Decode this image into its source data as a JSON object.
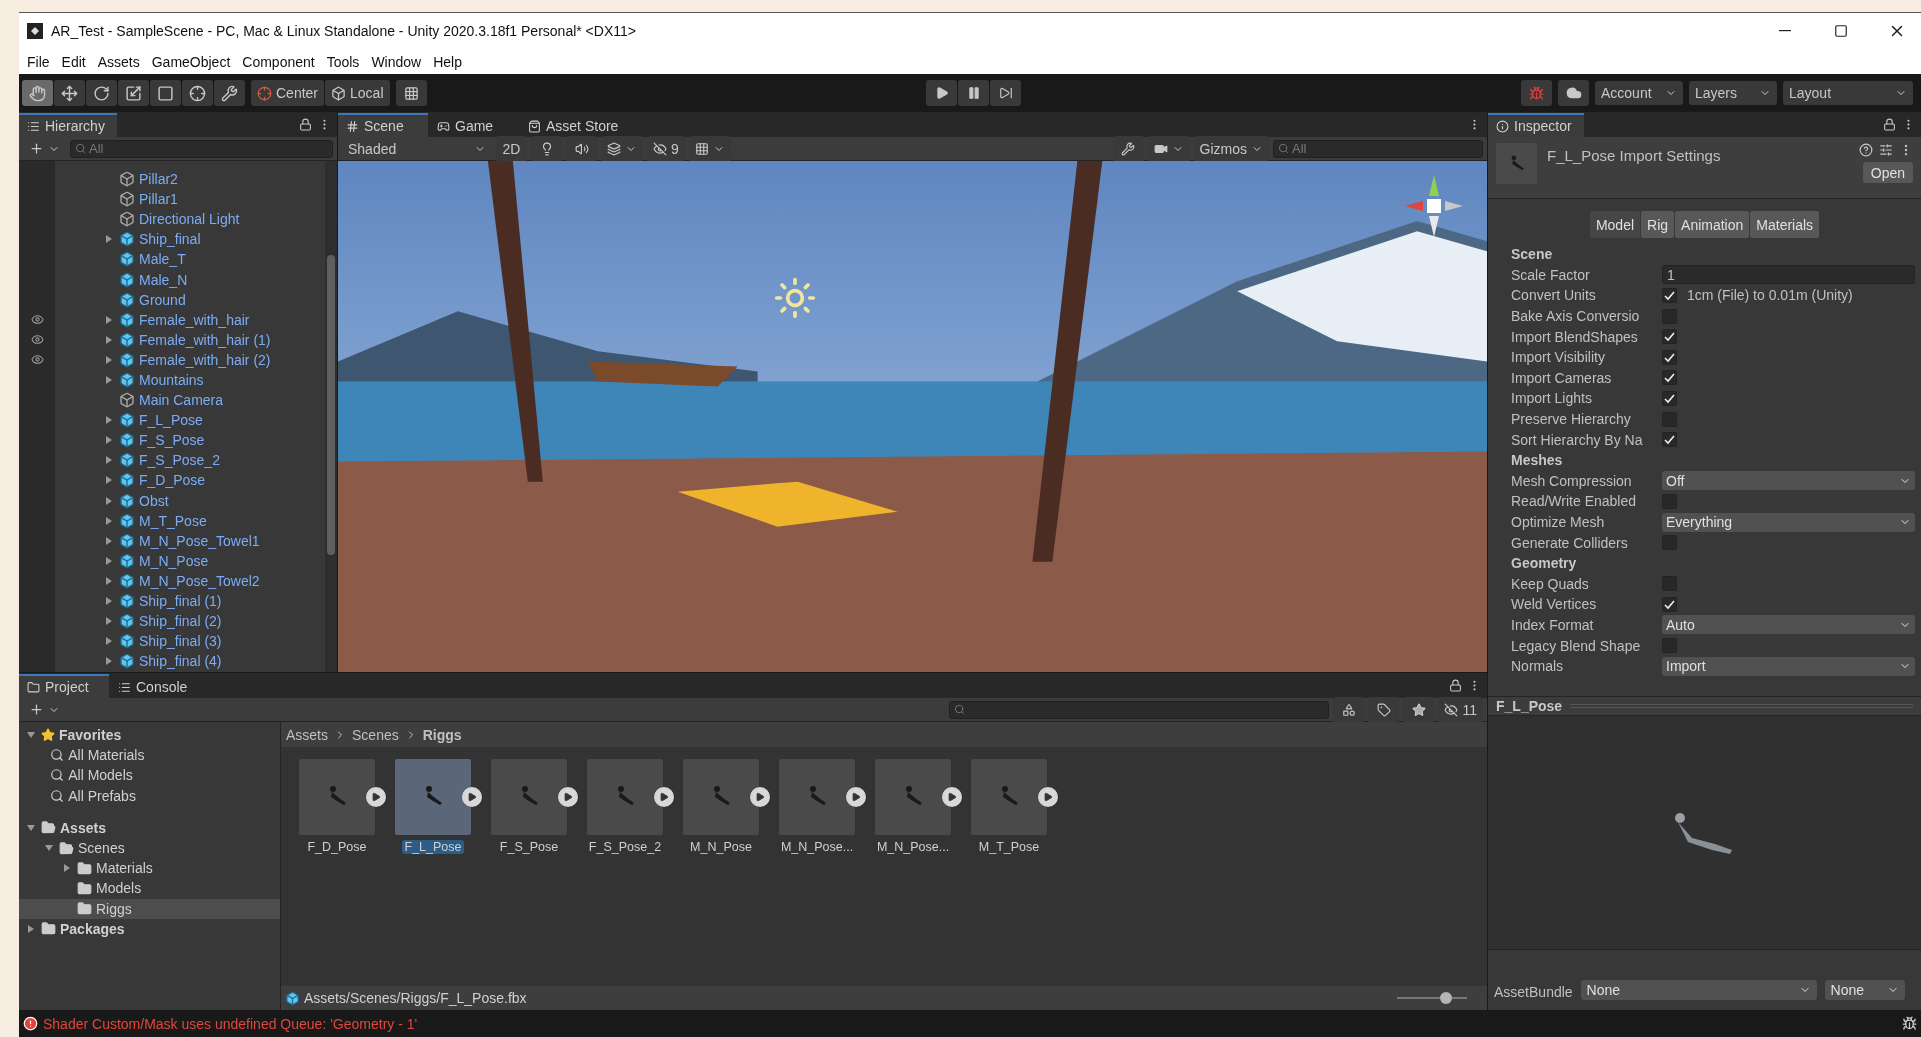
{
  "window": {
    "title": "AR_Test - SampleScene - PC, Mac & Linux Standalone - Unity 2020.3.18f1 Personal* <DX11>"
  },
  "menu": [
    "File",
    "Edit",
    "Assets",
    "GameObject",
    "Component",
    "Tools",
    "Window",
    "Help"
  ],
  "toolbar": {
    "tools": [
      {
        "kind": "hand",
        "selected": true
      },
      {
        "kind": "move",
        "selected": false
      },
      {
        "kind": "rotate",
        "selected": false
      },
      {
        "kind": "scale",
        "selected": false
      },
      {
        "kind": "rect",
        "selected": false
      },
      {
        "kind": "transform",
        "selected": false
      },
      {
        "kind": "custom",
        "selected": false
      }
    ],
    "pivot": [
      "Center",
      "Local"
    ],
    "account": "Account",
    "layers": "Layers",
    "layout": "Layout"
  },
  "hierarchy": {
    "title": "Hierarchy",
    "search": {
      "placeholder": "All"
    },
    "items": [
      {
        "label": "Pillar2",
        "kind": "object",
        "expandable": false,
        "hidden": false
      },
      {
        "label": "Pillar1",
        "kind": "object",
        "expandable": false,
        "hidden": false
      },
      {
        "label": "Directional Light",
        "kind": "object",
        "expandable": false,
        "hidden": false
      },
      {
        "label": "Ship_final",
        "kind": "prefab",
        "expandable": true,
        "hidden": false
      },
      {
        "label": "Male_T",
        "kind": "prefab",
        "expandable": false,
        "hidden": false
      },
      {
        "label": "Male_N",
        "kind": "prefab",
        "expandable": false,
        "hidden": false
      },
      {
        "label": "Ground",
        "kind": "prefab",
        "expandable": false,
        "hidden": false
      },
      {
        "label": "Female_with_hair",
        "kind": "prefab",
        "expandable": true,
        "hidden": true
      },
      {
        "label": "Female_with_hair (1)",
        "kind": "prefab",
        "expandable": true,
        "hidden": true
      },
      {
        "label": "Female_with_hair (2)",
        "kind": "prefab",
        "expandable": true,
        "hidden": true
      },
      {
        "label": "Mountains",
        "kind": "prefab",
        "expandable": true,
        "hidden": false
      },
      {
        "label": "Main Camera",
        "kind": "object",
        "expandable": false,
        "hidden": false
      },
      {
        "label": "F_L_Pose",
        "kind": "prefab",
        "expandable": true,
        "hidden": false
      },
      {
        "label": "F_S_Pose",
        "kind": "prefab",
        "expandable": true,
        "hidden": false
      },
      {
        "label": "F_S_Pose_2",
        "kind": "prefab",
        "expandable": true,
        "hidden": false
      },
      {
        "label": "F_D_Pose",
        "kind": "prefab",
        "expandable": true,
        "hidden": false
      },
      {
        "label": "Obst",
        "kind": "prefab",
        "expandable": true,
        "hidden": false
      },
      {
        "label": "M_T_Pose",
        "kind": "prefab",
        "expandable": true,
        "hidden": false
      },
      {
        "label": "M_N_Pose_Towel1",
        "kind": "prefab",
        "expandable": true,
        "hidden": false
      },
      {
        "label": "M_N_Pose",
        "kind": "prefab",
        "expandable": true,
        "hidden": false
      },
      {
        "label": "M_N_Pose_Towel2",
        "kind": "prefab",
        "expandable": true,
        "hidden": false
      },
      {
        "label": "Ship_final (1)",
        "kind": "prefab",
        "expandable": true,
        "hidden": false
      },
      {
        "label": "Ship_final (2)",
        "kind": "prefab",
        "expandable": true,
        "hidden": false
      },
      {
        "label": "Ship_final (3)",
        "kind": "prefab",
        "expandable": true,
        "hidden": false
      },
      {
        "label": "Ship_final (4)",
        "kind": "prefab",
        "expandable": true,
        "hidden": false
      }
    ]
  },
  "scene": {
    "tabs": [
      {
        "label": "Scene",
        "kind": "scene",
        "selected": true
      },
      {
        "label": "Game",
        "kind": "game",
        "selected": false
      },
      {
        "label": "Asset Store",
        "kind": "store",
        "selected": false
      }
    ],
    "shading": "Shaded",
    "mode_2d": "2D",
    "hidden_count": "9",
    "gizmos": "Gizmos",
    "search": {
      "placeholder": "All"
    }
  },
  "inspector": {
    "title": "Inspector",
    "asset_title": "F_L_Pose Import Settings",
    "open_button": "Open",
    "tabs": [
      {
        "label": "Model",
        "selected": true
      },
      {
        "label": "Rig",
        "selected": false
      },
      {
        "label": "Animation",
        "selected": false
      },
      {
        "label": "Materials",
        "selected": false
      }
    ],
    "rows": [
      {
        "kind": "header",
        "label": "Scene"
      },
      {
        "kind": "text",
        "label": "Scale Factor",
        "value": "1"
      },
      {
        "kind": "checkbox",
        "label": "Convert Units",
        "checked": true,
        "note": "1cm (File) to 0.01m (Unity)"
      },
      {
        "kind": "checkbox",
        "label": "Bake Axis Conversio",
        "checked": false
      },
      {
        "kind": "checkbox",
        "label": "Import BlendShapes",
        "checked": true
      },
      {
        "kind": "checkbox",
        "label": "Import Visibility",
        "checked": true
      },
      {
        "kind": "checkbox",
        "label": "Import Cameras",
        "checked": true
      },
      {
        "kind": "checkbox",
        "label": "Import Lights",
        "checked": true
      },
      {
        "kind": "checkbox",
        "label": "Preserve Hierarchy",
        "checked": false
      },
      {
        "kind": "checkbox",
        "label": "Sort Hierarchy By Na",
        "checked": true
      },
      {
        "kind": "header",
        "label": "Meshes"
      },
      {
        "kind": "dropdown",
        "label": "Mesh Compression",
        "value": "Off"
      },
      {
        "kind": "checkbox",
        "label": "Read/Write Enabled",
        "checked": false
      },
      {
        "kind": "dropdown",
        "label": "Optimize Mesh",
        "value": "Everything"
      },
      {
        "kind": "checkbox",
        "label": "Generate Colliders",
        "checked": false
      },
      {
        "kind": "header",
        "label": "Geometry"
      },
      {
        "kind": "checkbox",
        "label": "Keep Quads",
        "checked": false
      },
      {
        "kind": "checkbox",
        "label": "Weld Vertices",
        "checked": true
      },
      {
        "kind": "dropdown",
        "label": "Index Format",
        "value": "Auto"
      },
      {
        "kind": "checkbox",
        "label": "Legacy Blend Shape",
        "checked": false
      },
      {
        "kind": "dropdown",
        "label": "Normals",
        "value": "Import"
      }
    ],
    "preview_title": "F_L_Pose",
    "asset_bundle": {
      "label": "AssetBundle",
      "name": "None",
      "variant": "None"
    }
  },
  "project": {
    "tabs": [
      {
        "label": "Project",
        "kind": "project",
        "selected": true
      },
      {
        "label": "Console",
        "kind": "console",
        "selected": false
      }
    ],
    "hidden_count": "11",
    "favorites": {
      "label": "Favorites",
      "expanded": true,
      "items": [
        "All Materials",
        "All Models",
        "All Prefabs"
      ]
    },
    "tree": [
      {
        "label": "Assets",
        "expanded": true,
        "selected": false,
        "children": [
          {
            "label": "Scenes",
            "expanded": true,
            "selected": false,
            "children": [
              {
                "label": "Materials",
                "expanded": false,
                "selected": false
              },
              {
                "label": "Models",
                "selected": false
              },
              {
                "label": "Riggs",
                "selected": true
              }
            ]
          }
        ]
      },
      {
        "label": "Packages",
        "expanded": false,
        "selected": false
      }
    ],
    "breadcrumb": [
      "Assets",
      "Scenes",
      "Riggs"
    ],
    "assets": [
      {
        "label": "F_D_Pose",
        "selected": false
      },
      {
        "label": "F_L_Pose",
        "selected": true
      },
      {
        "label": "F_S_Pose",
        "selected": false
      },
      {
        "label": "F_S_Pose_2",
        "selected": false
      },
      {
        "label": "M_N_Pose",
        "selected": false
      },
      {
        "label": "M_N_Pose...",
        "selected": false
      },
      {
        "label": "M_N_Pose...",
        "selected": false
      },
      {
        "label": "M_T_Pose",
        "selected": false
      }
    ],
    "path": "Assets/Scenes/Riggs/F_L_Pose.fbx",
    "thumb_size": {
      "level": 0.7
    }
  },
  "status": {
    "message": "Shader Custom/Mask uses undefined Queue: 'Geometry - 1'"
  }
}
